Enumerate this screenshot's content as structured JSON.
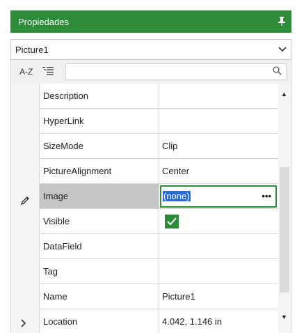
{
  "panel": {
    "title": "Propiedades",
    "pin_icon": "pin-icon"
  },
  "selector": {
    "value": "Picture1",
    "icon": "chevron-down-icon"
  },
  "toolbar": {
    "az_label": "A-Z",
    "categorized_icon": "categorized-list-icon",
    "search_placeholder": "",
    "search_icon": "search-icon"
  },
  "properties": [
    {
      "name": "Description",
      "value": ""
    },
    {
      "name": "HyperLink",
      "value": ""
    },
    {
      "name": "SizeMode",
      "value": "Clip"
    },
    {
      "name": "PictureAlignment",
      "value": "Center"
    },
    {
      "name": "Image",
      "value": "(none)",
      "selected": true
    },
    {
      "name": "Visible",
      "value": "",
      "checked": true
    },
    {
      "name": "DataField",
      "value": ""
    },
    {
      "name": "Tag",
      "value": ""
    },
    {
      "name": "Name",
      "value": "Picture1"
    },
    {
      "name": "Location",
      "value": "4.042, 1.146 in",
      "expandable": true
    }
  ],
  "colors": {
    "accent": "#2e8b3a",
    "selection": "#2a6bd6",
    "selected_row": "#c6c6c6"
  }
}
